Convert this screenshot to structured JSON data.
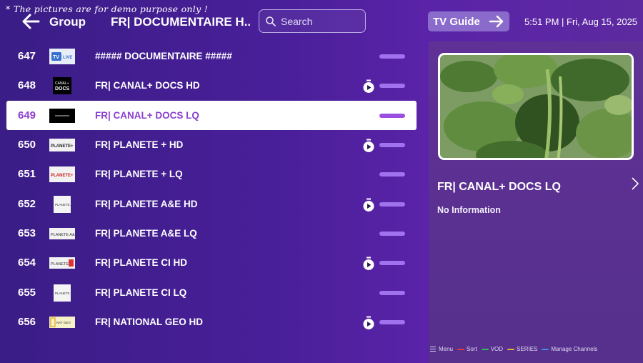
{
  "watermark": "* The pictures are for demo purpose only !",
  "header": {
    "group_label": "Group",
    "group_name": "FR| DOCUMENTAIRE H..",
    "search_placeholder": "Search",
    "tv_guide_label": "TV Guide",
    "datetime": "5:51 PM | Fri, Aug 15, 2025"
  },
  "channels": [
    {
      "num": "647",
      "name": "##### DOCUMENTAIRE #####",
      "logo": "tv-live-logo",
      "catchup": false,
      "selected": false
    },
    {
      "num": "648",
      "name": "FR| CANAL+ DOCS HD",
      "logo": "canal-docs-logo",
      "catchup": true,
      "selected": false
    },
    {
      "num": "649",
      "name": "FR| CANAL+ DOCS LQ",
      "logo": "canal-docs-black-logo",
      "catchup": false,
      "selected": true
    },
    {
      "num": "650",
      "name": "FR| PLANETE + HD",
      "logo": "planete-logo",
      "catchup": true,
      "selected": false
    },
    {
      "num": "651",
      "name": "FR| PLANETE + LQ",
      "logo": "planete-red-logo",
      "catchup": false,
      "selected": false
    },
    {
      "num": "652",
      "name": "FR| PLANETE A&E HD",
      "logo": "planete-ae-logo",
      "catchup": true,
      "selected": false
    },
    {
      "num": "653",
      "name": "FR| PLANETE A&E LQ",
      "logo": "planete-ae-wide-logo",
      "catchup": false,
      "selected": false
    },
    {
      "num": "654",
      "name": "FR| PLANETE CI HD",
      "logo": "planete-ci-logo",
      "catchup": true,
      "selected": false
    },
    {
      "num": "655",
      "name": "FR| PLANETE CI LQ",
      "logo": "planete-ci-small-logo",
      "catchup": false,
      "selected": false
    },
    {
      "num": "656",
      "name": "FR| NATIONAL GEO HD",
      "logo": "national-geo-logo",
      "catchup": true,
      "selected": false
    }
  ],
  "info_panel": {
    "title": "FR| CANAL+ DOCS LQ",
    "description": "No Information"
  },
  "legend": [
    {
      "label": "Menu",
      "icon": "menu-icon",
      "color": ""
    },
    {
      "label": "Sort",
      "color": "#e23b3b"
    },
    {
      "label": "VOD",
      "color": "#2fbf5a"
    },
    {
      "label": "SERIES",
      "color": "#e2b52a"
    },
    {
      "label": "Manage Channels",
      "color": "#3d8fe0"
    }
  ],
  "colors": {
    "accent": "#8a3fd1",
    "bar": "#a072ee",
    "button": "#8a6bcc"
  }
}
